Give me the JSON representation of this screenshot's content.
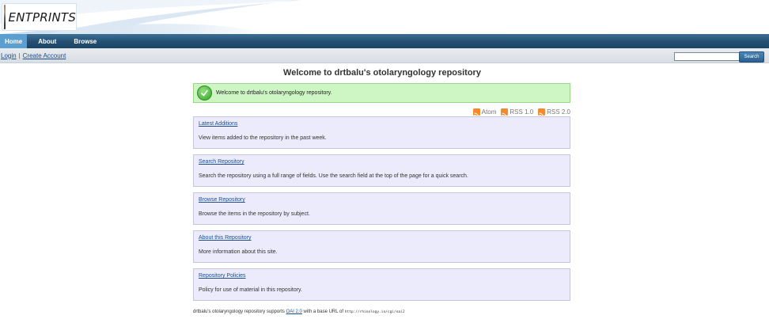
{
  "header": {
    "logo_text": "ENTPRINTS",
    "avatar_icon": "portrait-photo"
  },
  "nav": {
    "items": [
      {
        "label": "Home",
        "active": true
      },
      {
        "label": "About",
        "active": false
      },
      {
        "label": "Browse",
        "active": false
      }
    ]
  },
  "account": {
    "login": "Login",
    "separator": "|",
    "create": "Create Account"
  },
  "search": {
    "value": "",
    "button": "Search"
  },
  "main": {
    "title": "Welcome to drtbalu's otolaryngology repository",
    "welcome_message": "Welcome to drtbalu's otolaryngology repository.",
    "feeds": [
      {
        "label": "Atom"
      },
      {
        "label": "RSS 1.0"
      },
      {
        "label": "RSS 2.0"
      }
    ],
    "panels": [
      {
        "link": "Latest Additions",
        "desc": "View items added to the repository in the past week."
      },
      {
        "link": "Search Repository",
        "desc": "Search the repository using a full range of fields. Use the search field at the top of the page for a quick search."
      },
      {
        "link": "Browse Repository",
        "desc": "Browse the items in the repository by subject."
      },
      {
        "link": "About this Repository",
        "desc": "More information about this site."
      },
      {
        "link": "Repository Policies",
        "desc": "Policy for use of material in this repository."
      }
    ],
    "footer": {
      "pre": "drtbalu's otolaryngology repository supports ",
      "oai_link": "OAI 2.0",
      "mid": " with a base URL of ",
      "base_url": "http://rhinology.in/cgi/oai2"
    }
  },
  "colors": {
    "nav_bg": "#244f73",
    "nav_active": "#5b9fd0",
    "welcome_bg": "#cdf6c4",
    "panel_bg": "#ebebfb",
    "link": "#1d4f8c",
    "rss": "#f58a2a"
  }
}
